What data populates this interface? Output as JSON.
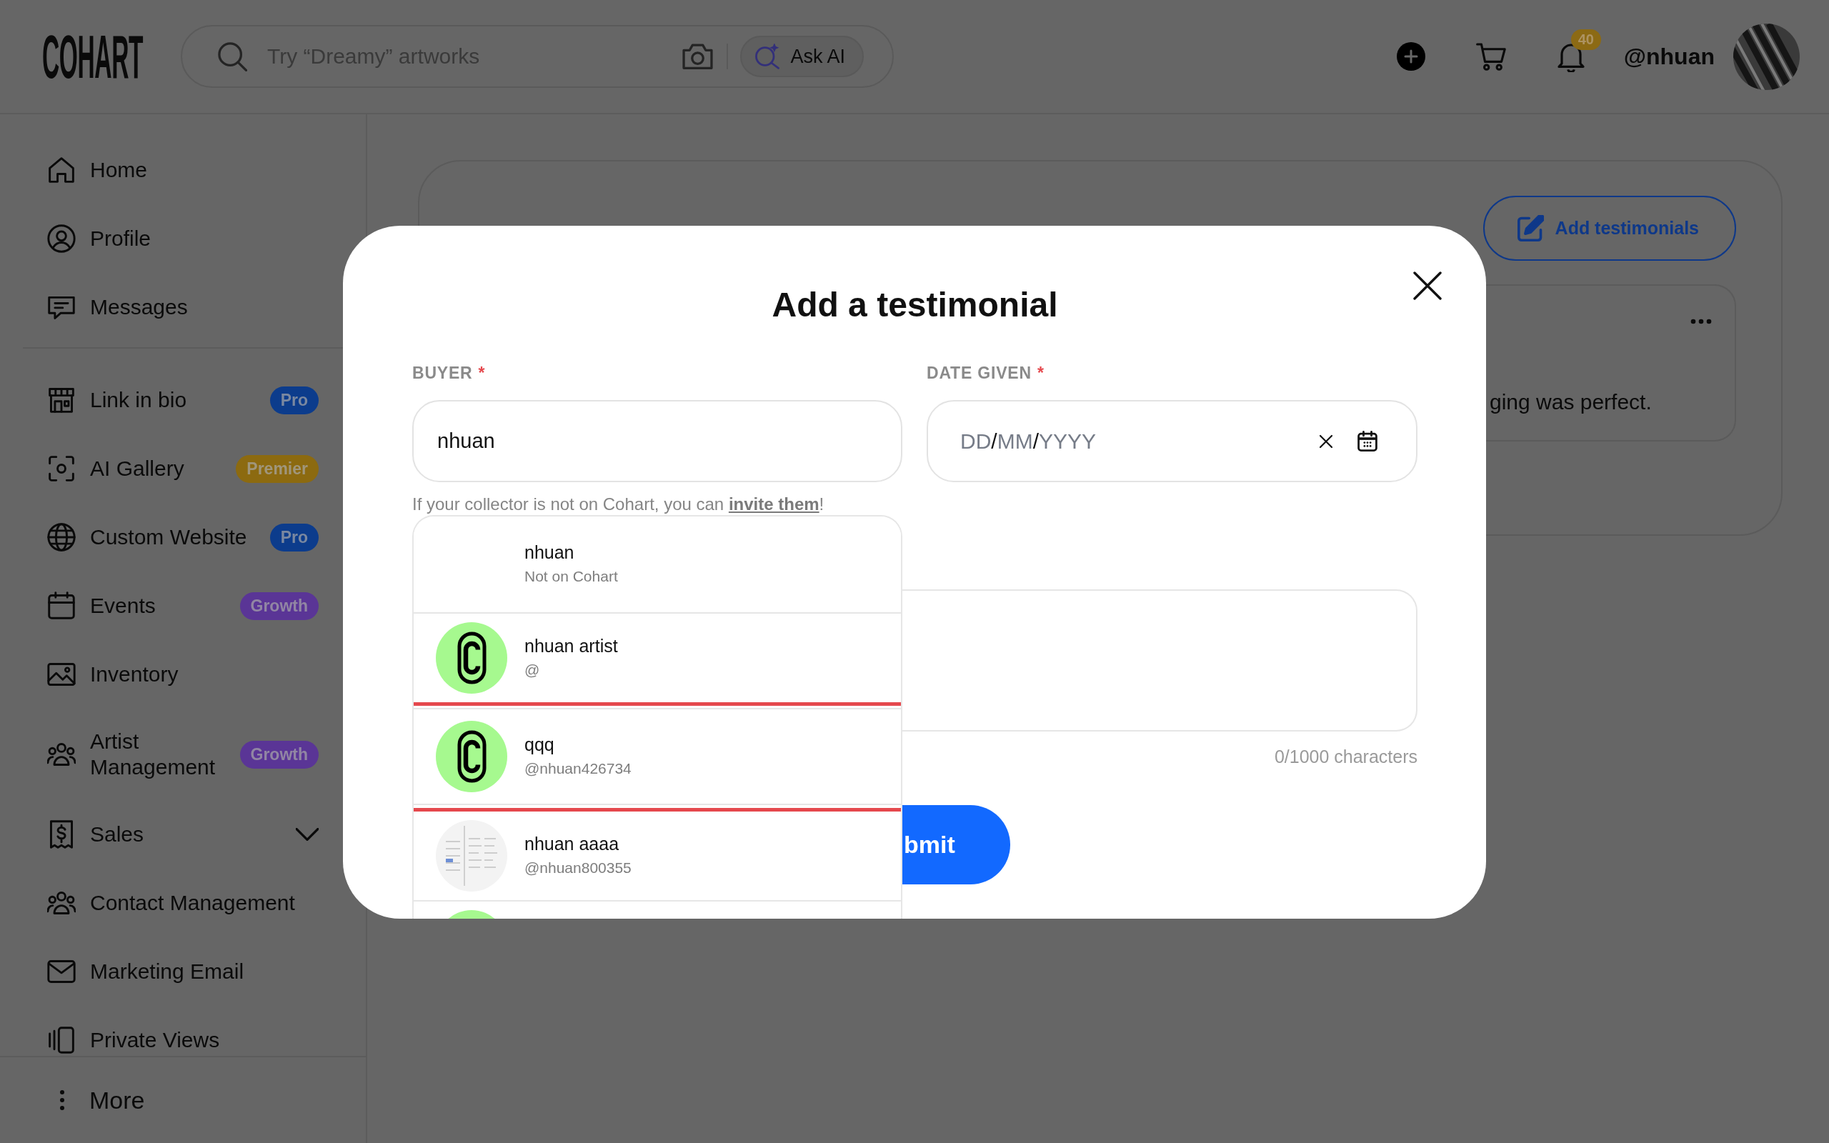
{
  "header": {
    "logo": "COHART",
    "search": {
      "placeholder": "Try “Dreamy” artworks"
    },
    "ask_ai": {
      "label": "Ask AI"
    },
    "notifications": {
      "count": "40"
    },
    "username": "@nhuan"
  },
  "sidebar": {
    "sections": [
      {
        "items": [
          {
            "label": "Home"
          },
          {
            "label": "Profile"
          },
          {
            "label": "Messages"
          }
        ]
      },
      {
        "items": [
          {
            "label": "Link in bio",
            "badge": {
              "label": "Pro",
              "color": "#0c3c8c"
            }
          },
          {
            "label": "AI Gallery",
            "badge": {
              "label": "Premier",
              "color": "#8c6a10"
            }
          },
          {
            "label": "Custom Website",
            "badge": {
              "label": "Pro",
              "color": "#0c3c8c"
            }
          },
          {
            "label": "Events",
            "badge": {
              "label": "Growth",
              "color": "#5a3596"
            }
          },
          {
            "label": "Inventory"
          },
          {
            "label": "Artist Management",
            "badge": {
              "label": "Growth",
              "color": "#5a3596"
            }
          },
          {
            "label": "Sales",
            "expanded": false
          },
          {
            "label": "Contact Management"
          },
          {
            "label": "Marketing Email"
          },
          {
            "label": "Private Views"
          }
        ]
      }
    ],
    "more": {
      "label": "More"
    }
  },
  "main": {
    "add_button": {
      "label": "Add testimonials"
    },
    "testimonial": {
      "text": "ging was perfect."
    }
  },
  "modal": {
    "title": "Add a testimonial",
    "buyer": {
      "label": "BUYER",
      "required_mark": "*",
      "value": "nhuan",
      "help": {
        "before": "If your collector is not on Cohart, you can ",
        "link": "invite them",
        "after": "!"
      },
      "suggestions": [
        {
          "kind": "plain",
          "name": "nhuan",
          "handle": "Not on Cohart",
          "focused": false
        },
        {
          "kind": "logo",
          "name": "nhuan artist",
          "handle": "@",
          "focused": false
        },
        {
          "kind": "logo",
          "name": "qqq",
          "handle": "@nhuan426734",
          "focused": true
        },
        {
          "kind": "photo",
          "name": "nhuan aaaa",
          "handle": "@nhuan800355",
          "focused": false
        },
        {
          "kind": "logo",
          "focused": false
        }
      ]
    },
    "date_given": {
      "label": "DATE GIVEN",
      "required_mark": "*",
      "parts": [
        {
          "kind": "placeholder",
          "text": "DD"
        },
        {
          "kind": "separator",
          "text": "/"
        },
        {
          "kind": "placeholder",
          "text": "MM"
        },
        {
          "kind": "separator",
          "text": "/"
        },
        {
          "kind": "placeholder",
          "text": "YYYY"
        }
      ]
    },
    "message": {
      "counter": "0/1000 characters"
    },
    "submit": {
      "label": "bmit"
    }
  }
}
